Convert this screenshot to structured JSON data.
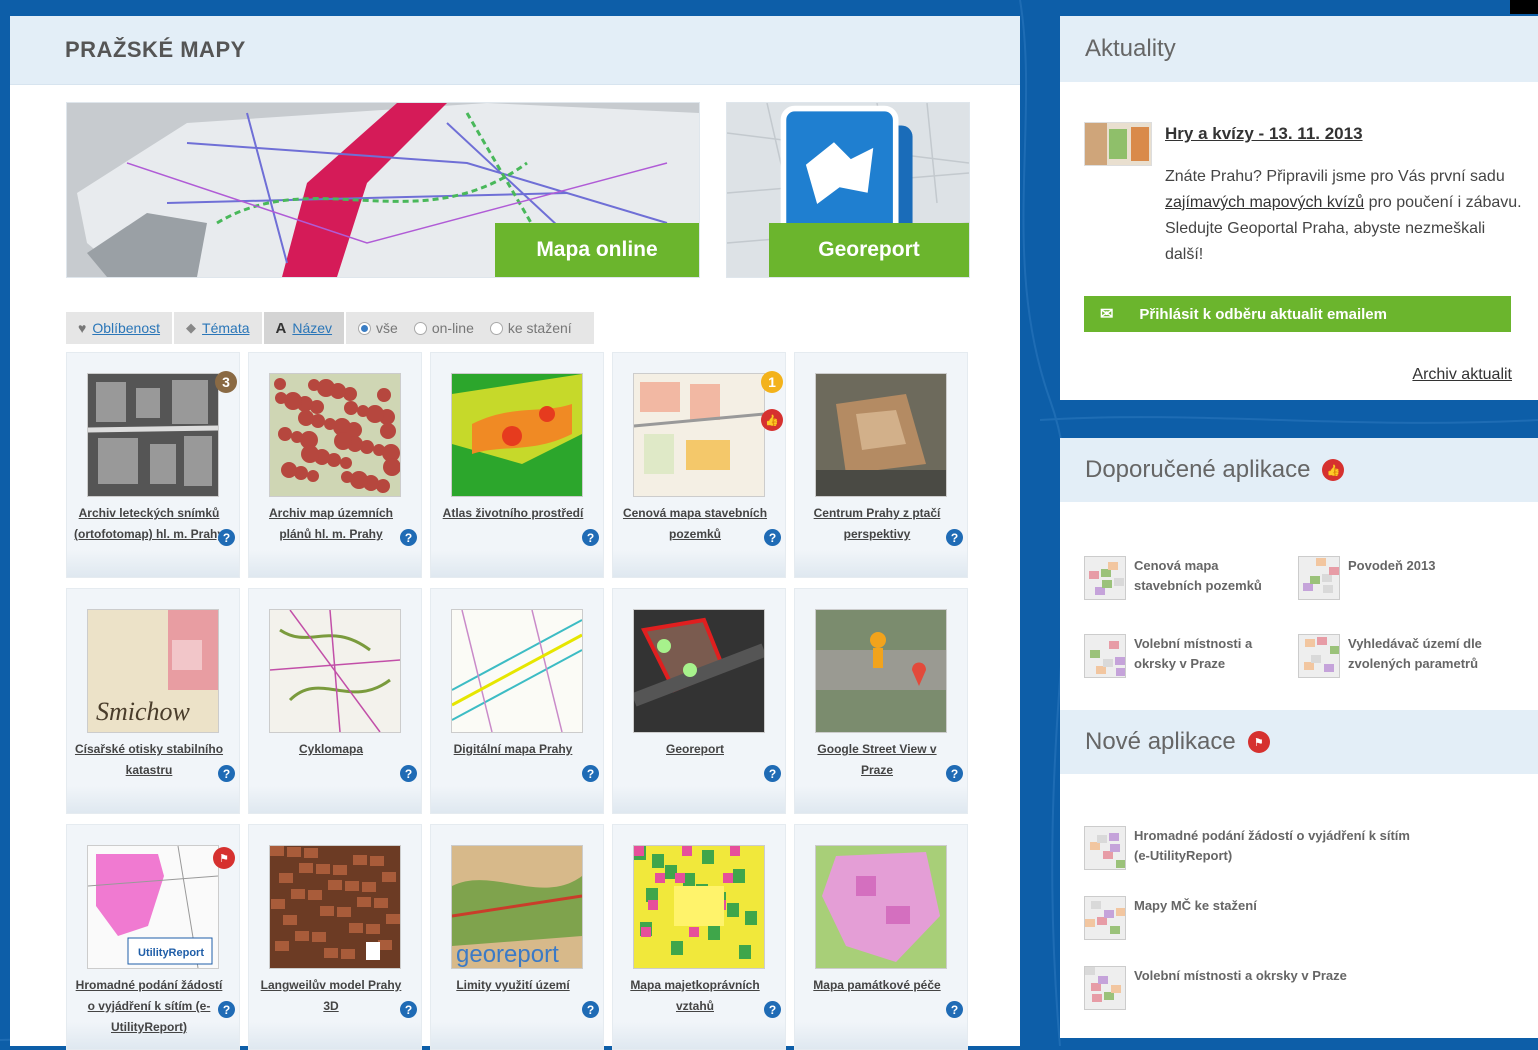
{
  "left": {
    "title": "PRAŽSKÉ MAPY",
    "banner_map_label": "Mapa online",
    "banner_geo_label": "Georeport",
    "filters": {
      "popularity": "Oblíbenost",
      "themes": "Témata",
      "name_prefix": "A",
      "name": "Název",
      "radio_all": "vše",
      "radio_online": "on-line",
      "radio_download": "ke stažení"
    },
    "help_glyph": "?",
    "tiles": [
      {
        "title": "Archiv leteckých snímků (ortofotomap) hl. m. Prahy",
        "badge": "3",
        "thumb": "aerial-bw"
      },
      {
        "title": "Archiv map územních plánů hl. m. Prahy",
        "thumb": "plan-red"
      },
      {
        "title": "Atlas životního prostředí",
        "thumb": "env-atlas"
      },
      {
        "title": "Cenová mapa stavebních pozemků",
        "badge": "1",
        "thumb": "price-map",
        "liked": true
      },
      {
        "title": "Centrum Prahy z ptačí perspektivy",
        "thumb": "aerial-color"
      },
      {
        "title": "Císařské otisky stabilního katastru",
        "thumb": "cadastre"
      },
      {
        "title": "Cyklomapa",
        "thumb": "cyclo"
      },
      {
        "title": "Digitální mapa Prahy",
        "thumb": "digital"
      },
      {
        "title": "Georeport",
        "thumb": "georeport"
      },
      {
        "title": "Google Street View v Praze",
        "thumb": "streetview"
      },
      {
        "title": "Hromadné podání žádostí o vyjádření k sítím (e-UtilityReport)",
        "thumb": "utility",
        "flagged": true
      },
      {
        "title": "Langweilův model Prahy 3D",
        "thumb": "langweil"
      },
      {
        "title": "Limity využití území",
        "thumb": "limits"
      },
      {
        "title": "Mapa majetkoprávních vztahů",
        "thumb": "property"
      },
      {
        "title": "Mapa památkové péče",
        "thumb": "monuments"
      }
    ]
  },
  "news": {
    "title": "Aktuality",
    "item_title": "Hry a kvízy - 13. 11. 2013",
    "text_before": "Znáte Prahu? Připravili jsme pro Vás první sadu ",
    "text_link": "zajímavých mapových kvízů",
    "text_after": " pro poučení i zábavu. Sledujte Geoportal Praha, abyste nezmeškali další!",
    "subscribe": "Přihlásit k odběru aktualit emailem",
    "archive": "Archiv aktualit"
  },
  "apps": {
    "recommended_title": "Doporučené aplikace",
    "recommended": [
      {
        "line1": "Cenová mapa",
        "line2": "stavebních pozemků"
      },
      {
        "line1": "Povodeň 2013",
        "line2": ""
      },
      {
        "line1": "Volební místnosti a",
        "line2": "okrsky v Praze"
      },
      {
        "line1": "Vyhledávač území dle",
        "line2": "zvolených parametrů"
      }
    ],
    "new_title": "Nové aplikace",
    "new": [
      {
        "line1": "Hromadné podání žádostí o vyjádření k sítím",
        "line2": "(e-UtilityReport)"
      },
      {
        "line1": "Mapy MČ ke stažení",
        "line2": ""
      },
      {
        "line1": "Volební místnosti a okrsky v Praze",
        "line2": ""
      }
    ]
  },
  "colors": {
    "accent_green": "#6bb52d",
    "link_blue": "#2a76b8",
    "alert_red": "#d6312f",
    "bg_blue": "#0d5ea8"
  }
}
